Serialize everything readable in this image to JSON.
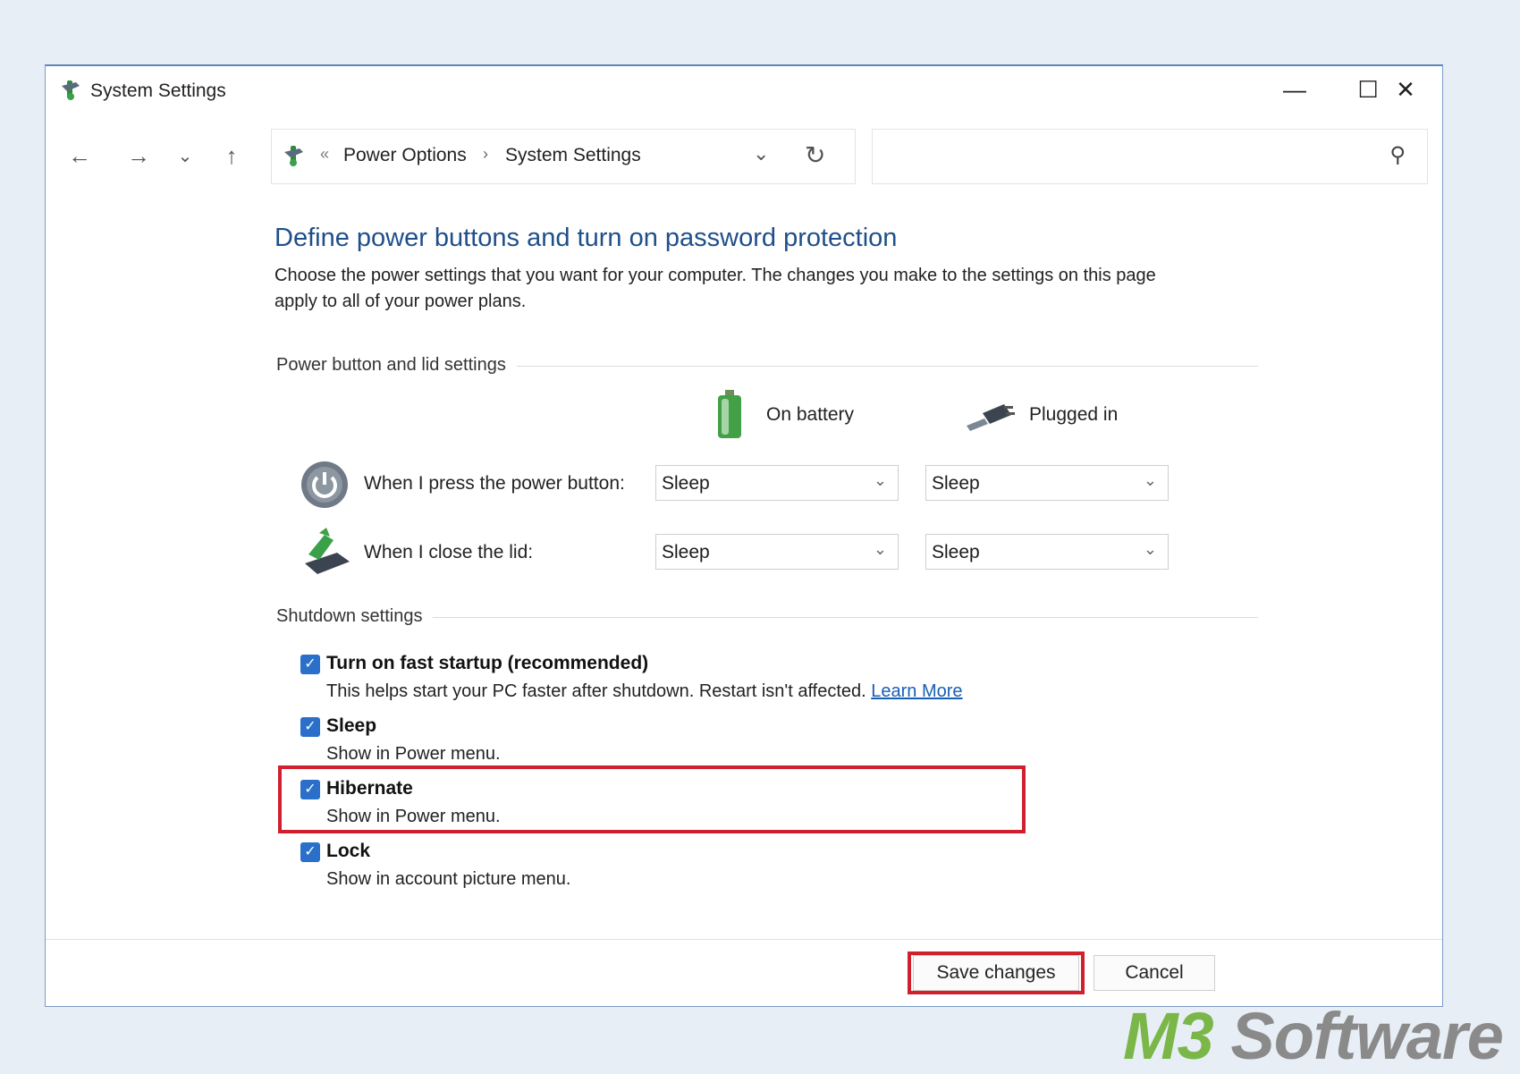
{
  "window": {
    "title": "System Settings",
    "controls": {
      "minimize": "—",
      "maximize": "☐",
      "close": "✕"
    }
  },
  "toolbar": {
    "back": "←",
    "forward": "→",
    "recent": "⌄",
    "up": "↑",
    "breadcrumb": {
      "overflow": "«",
      "parent": "Power Options",
      "separator": "›",
      "current": "System Settings"
    },
    "address_dropdown": "⌄",
    "refresh": "↻",
    "search_value": "",
    "search_icon": "⚲"
  },
  "main": {
    "heading": "Define power buttons and turn on password protection",
    "description": "Choose the power settings that you want for your computer. The changes you make to the settings on this page apply to all of your power plans.",
    "power_section_title": "Power button and lid settings",
    "columns": {
      "battery": "On battery",
      "plugged": "Plugged in"
    },
    "rows": [
      {
        "label": "When I press the power button:",
        "battery": "Sleep",
        "plugged": "Sleep",
        "icon": "power-button-icon"
      },
      {
        "label": "When I close the lid:",
        "battery": "Sleep",
        "plugged": "Sleep",
        "icon": "laptop-lid-icon"
      }
    ],
    "shutdown_section_title": "Shutdown settings",
    "shutdown_options": [
      {
        "label": "Turn on fast startup (recommended)",
        "desc": "This helps start your PC faster after shutdown. Restart isn't affected. ",
        "link": "Learn More",
        "checked": true
      },
      {
        "label": "Sleep",
        "desc": "Show in Power menu.",
        "checked": true
      },
      {
        "label": "Hibernate",
        "desc": "Show in Power menu.",
        "checked": true
      },
      {
        "label": "Lock",
        "desc": "Show in account picture menu.",
        "checked": true
      }
    ],
    "check_glyph": "✓"
  },
  "footer": {
    "save": "Save changes",
    "cancel": "Cancel"
  },
  "watermark": {
    "brand_a": "M3",
    "brand_b": " Software"
  },
  "colors": {
    "heading": "#1f4f8a",
    "checkbox": "#2a6fc9",
    "highlight": "#d0202e",
    "link": "#1a5fb4"
  }
}
